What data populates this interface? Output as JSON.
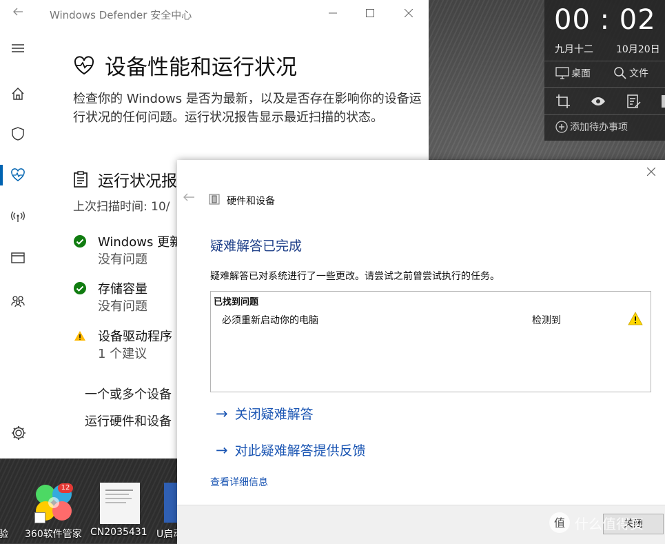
{
  "defender": {
    "title": "Windows Defender 安全中心",
    "page_title": "设备性能和运行状况",
    "page_desc": "检查你的 Windows 是否为最新，以及是否存在影响你的设备运行状况的任何问题。运行状况报告显示最近扫描的状态。",
    "section_title": "运行状况报",
    "scan_time": "上次扫描时间: 10/",
    "items": [
      {
        "name": "Windows 更新",
        "sub": "没有问题",
        "status": "ok"
      },
      {
        "name": "存储容量",
        "sub": "没有问题",
        "status": "ok"
      },
      {
        "name": "设备驱动程序",
        "sub": "1 个建议",
        "status": "warning"
      }
    ],
    "driver_note_1": "一个或多个设备",
    "driver_note_2": "运行硬件和设备",
    "nav": [
      "menu-icon",
      "home-icon",
      "shield-icon",
      "heart-icon",
      "antenna-icon",
      "browser-icon",
      "family-icon",
      "gear-icon"
    ],
    "colors": {
      "accent": "#0063b1",
      "ok": "#107c10",
      "warning": "#ffb900"
    }
  },
  "clock": {
    "time": "00 : 02",
    "lunar": "九月十二",
    "date": "10月20日",
    "desktop_label": "桌面",
    "file_label": "文件",
    "add_todo": "添加待办事项"
  },
  "dialog": {
    "app_title": "硬件和设备",
    "heading": "疑难解答已完成",
    "desc": "疑难解答已对系统进行了一些更改。请尝试之前曾尝试执行的任务。",
    "problems_header": "已找到问题",
    "problem_name": "必须重新启动你的电脑",
    "problem_status": "检测到",
    "link_close": "关闭疑难解答",
    "link_feedback": "对此疑难解答提供反馈",
    "details": "查看详细信息",
    "close_button": "关闭",
    "colors": {
      "link": "#1a55b3",
      "heading": "#1e3f88"
    }
  },
  "desktop": {
    "icons": [
      {
        "label": "验"
      },
      {
        "label": "360软件管家",
        "badge": "12"
      },
      {
        "label": "CN2035431"
      },
      {
        "label": "U启动"
      }
    ],
    "watermark": "什么值得买"
  }
}
